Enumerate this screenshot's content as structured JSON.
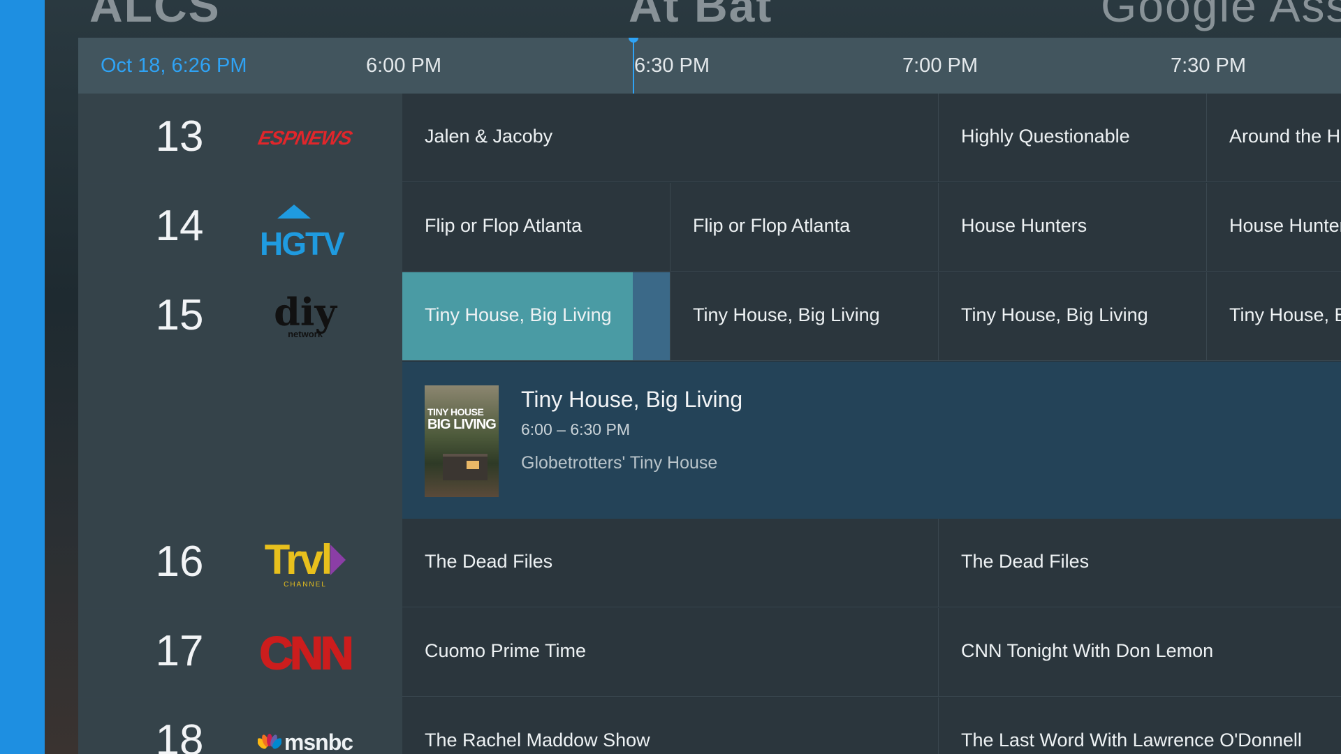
{
  "background": {
    "titles": [
      "ALCS",
      "At Bat",
      "Google Assistant"
    ]
  },
  "guide": {
    "current_time": "Oct 18, 6:26 PM",
    "time_slots": [
      "6:00 PM",
      "6:30 PM",
      "7:00 PM",
      "7:30 PM"
    ]
  },
  "channels": [
    {
      "number": "13",
      "logo": "ESPNEWS",
      "programs": [
        "Jalen & Jacoby",
        "Highly Questionable",
        "Around the Ho"
      ]
    },
    {
      "number": "14",
      "logo": "HGTV",
      "programs": [
        "Flip or Flop Atlanta",
        "Flip or Flop Atlanta",
        "House Hunters",
        "House Hunters"
      ]
    },
    {
      "number": "15",
      "logo": "diy",
      "logo_sub": "network",
      "programs": [
        "Tiny House, Big Living",
        "Tiny House, Big Living",
        "Tiny House, Big Living",
        "Tiny House, Bi"
      ]
    },
    {
      "number": "16",
      "logo": "Trvl",
      "logo_sub": "CHANNEL",
      "programs": [
        "The Dead Files",
        "The Dead Files"
      ]
    },
    {
      "number": "17",
      "logo": "CNN",
      "programs": [
        "Cuomo Prime Time",
        "CNN Tonight With Don Lemon"
      ]
    },
    {
      "number": "18",
      "logo": "msnbc",
      "programs": [
        "The Rachel Maddow Show",
        "The Last Word With Lawrence O'Donnell"
      ]
    }
  ],
  "detail": {
    "title": "Tiny House, Big Living",
    "time": "6:00 – 6:30 PM",
    "episode": "Globetrotters' Tiny House",
    "poster_text_1": "TINY HOUSE",
    "poster_text_2": "BIG LIVING"
  },
  "colors": {
    "accent": "#2fa3f5",
    "selected_program": "#4a9ba4",
    "detail_background": "#244358",
    "left_stripe": "#1e8fe1"
  }
}
